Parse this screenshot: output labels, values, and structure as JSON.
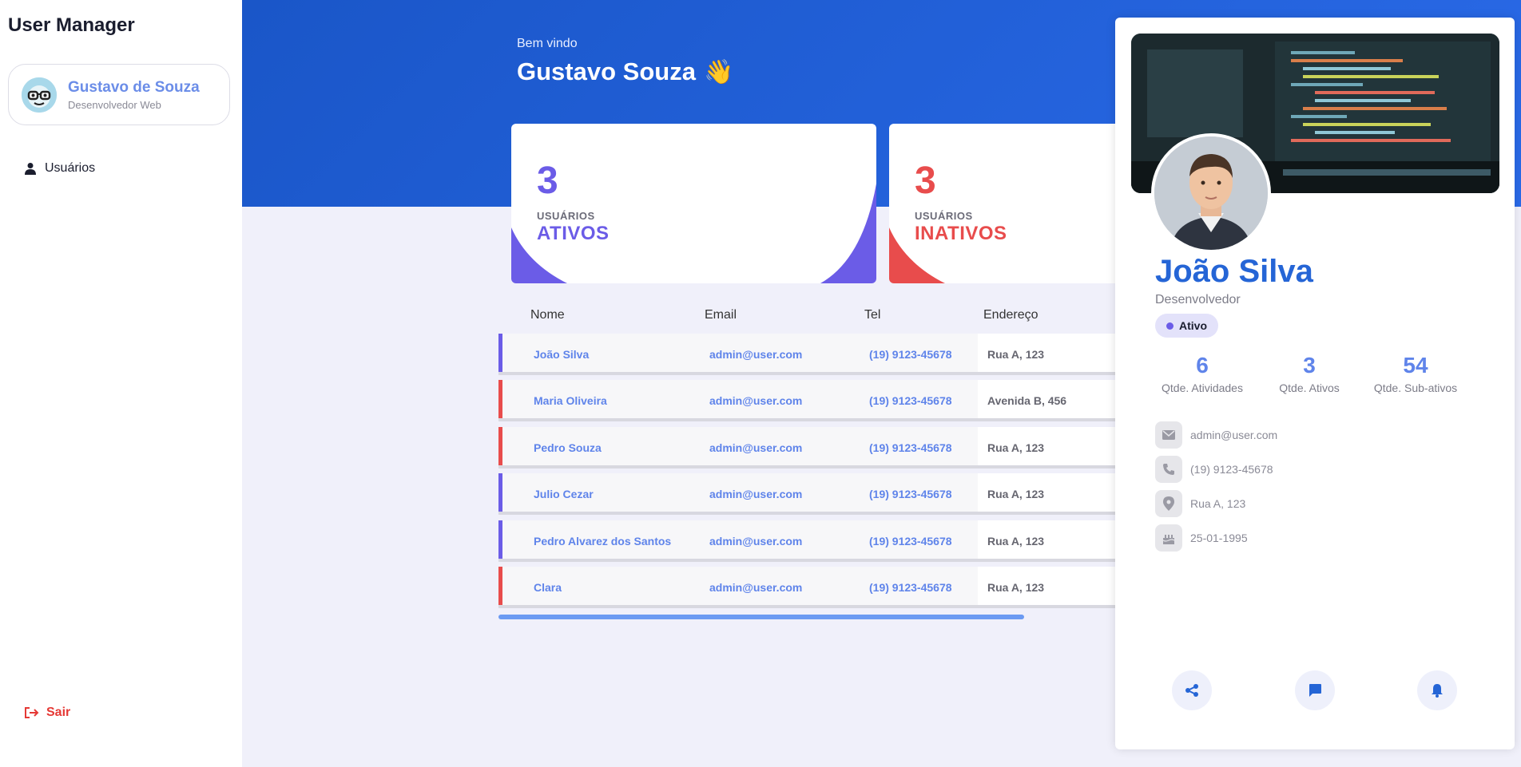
{
  "app": {
    "title": "User Manager"
  },
  "profile": {
    "name": "Gustavo de Souza",
    "role": "Desenvolvedor Web"
  },
  "nav": {
    "users_label": "Usuários",
    "logout_label": "Sair"
  },
  "header": {
    "welcome": "Bem vindo",
    "name": "Gustavo Souza",
    "emoji": "👋"
  },
  "stats": {
    "active": {
      "count": "3",
      "label": "USUÁRIOS",
      "word": "ATIVOS",
      "color": "#6b5ce7"
    },
    "inactive": {
      "count": "3",
      "label": "USUÁRIOS",
      "word": "INATIVOS",
      "color": "#e84c4c"
    }
  },
  "table": {
    "headers": {
      "name": "Nome",
      "email": "Email",
      "tel": "Tel",
      "address": "Endereço"
    },
    "rows": [
      {
        "name": "João Silva",
        "email": "admin@user.com",
        "tel": "(19) 9123-45678",
        "address": "Rua A, 123",
        "status": "active"
      },
      {
        "name": "Maria Oliveira",
        "email": "admin@user.com",
        "tel": "(19) 9123-45678",
        "address": "Avenida B, 456",
        "status": "inactive"
      },
      {
        "name": "Pedro Souza",
        "email": "admin@user.com",
        "tel": "(19) 9123-45678",
        "address": "Rua A, 123",
        "status": "inactive"
      },
      {
        "name": "Julio Cezar",
        "email": "admin@user.com",
        "tel": "(19) 9123-45678",
        "address": "Rua A, 123",
        "status": "active"
      },
      {
        "name": "Pedro Alvarez dos Santos",
        "email": "admin@user.com",
        "tel": "(19) 9123-45678",
        "address": "Rua A, 123",
        "status": "active"
      },
      {
        "name": "Clara",
        "email": "admin@user.com",
        "tel": "(19) 9123-45678",
        "address": "Rua A, 123",
        "status": "inactive"
      }
    ]
  },
  "detail": {
    "name": "João Silva",
    "role": "Desenvolvedor",
    "status": "Ativo",
    "stats": [
      {
        "value": "6",
        "label": "Qtde. Atividades"
      },
      {
        "value": "3",
        "label": "Qtde. Ativos"
      },
      {
        "value": "54",
        "label": "Qtde. Sub-ativos"
      }
    ],
    "email": "admin@user.com",
    "phone": "(19) 9123-45678",
    "address": "Rua A, 123",
    "birthday": "25-01-1995",
    "actions": [
      "share-icon",
      "chat-icon",
      "bell-icon"
    ]
  },
  "colors": {
    "active": "#6b5ce7",
    "inactive": "#e84c4c",
    "link": "#5f84ea",
    "primary": "#2565d6"
  }
}
